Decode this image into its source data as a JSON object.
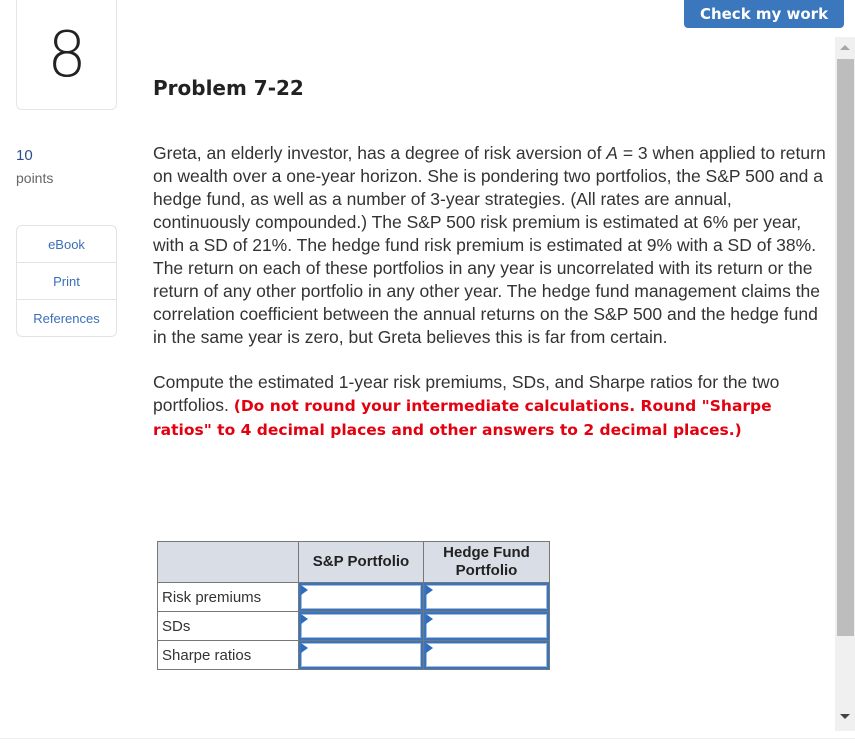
{
  "header": {
    "check_button": "Check my work",
    "question_number": "8",
    "problem_title": "Problem 7-22"
  },
  "sidebar": {
    "points_value": "10",
    "points_label": "points",
    "links": [
      {
        "label": "eBook"
      },
      {
        "label": "Print"
      },
      {
        "label": "References"
      }
    ]
  },
  "question": {
    "para1_before_var": "Greta, an elderly investor, has a degree of risk aversion of ",
    "var_name": "A",
    "para1_after_var": " = 3 when applied to return on wealth over a one-year horizon. She is pondering two portfolios, the S&P 500 and a hedge fund, as well as a number of 3-year strategies. (All rates are annual, continuously compounded.) The S&P 500 risk premium is estimated at 6% per year, with a SD of 21%. The hedge fund risk premium is estimated at 9% with a SD of 38%. The return on each of these portfolios in any year is uncorrelated with its return or the return of any other portfolio in any other year. The hedge fund management claims the correlation coefficient between the annual returns on the S&P 500 and the hedge fund in the same year is zero, but Greta believes this is far from certain.",
    "para2_text": "Compute the estimated 1-year risk premiums, SDs, and Sharpe ratios for the two portfolios. ",
    "para2_instruction": "(Do not round your intermediate calculations. Round \"Sharpe ratios\" to 4 decimal places and other answers to 2 decimal places.)"
  },
  "answer_table": {
    "headers": [
      "",
      "S&P Portfolio",
      "Hedge Fund Portfolio"
    ],
    "rows": [
      {
        "label": "Risk premiums",
        "sp_value": "",
        "hf_value": ""
      },
      {
        "label": "SDs",
        "sp_value": "",
        "hf_value": ""
      },
      {
        "label": "Sharpe ratios",
        "sp_value": "",
        "hf_value": ""
      }
    ]
  },
  "colors": {
    "accent": "#3b77bd",
    "instruction_red": "#e3000f",
    "table_header_bg": "#d9dde6"
  }
}
